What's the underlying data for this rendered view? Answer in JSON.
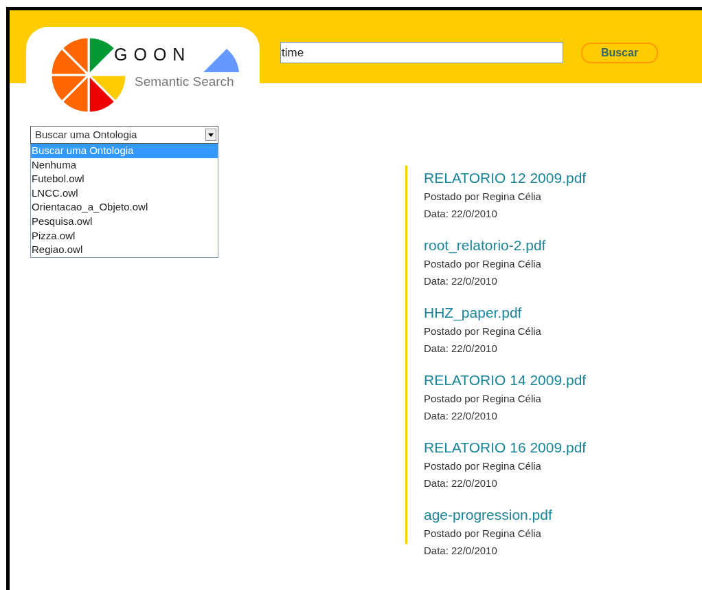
{
  "logo": {
    "name": "GOON",
    "subtitle": "Semantic Search"
  },
  "search": {
    "value": "time",
    "button": "Buscar"
  },
  "ontology_select": {
    "value": "Buscar uma Ontologia",
    "expanded": true,
    "options": [
      {
        "label": "Buscar uma Ontologia",
        "selected": true
      },
      {
        "label": "Nenhuma",
        "selected": false
      },
      {
        "label": "Futebol.owl",
        "selected": false
      },
      {
        "label": "LNCC.owl",
        "selected": false
      },
      {
        "label": "Orientacao_a_Objeto.owl",
        "selected": false
      },
      {
        "label": "Pesquisa.owl",
        "selected": false
      },
      {
        "label": "Pizza.owl",
        "selected": false
      },
      {
        "label": "Regiao.owl",
        "selected": false
      }
    ]
  },
  "results": [
    {
      "title": "RELATORIO 12 2009.pdf",
      "author": "Postado por Regina Célia",
      "date": "Data: 22/0/2010"
    },
    {
      "title": "root_relatorio-2.pdf",
      "author": "Postado por Regina Célia",
      "date": "Data: 22/0/2010"
    },
    {
      "title": "HHZ_paper.pdf",
      "author": "Postado por Regina Célia",
      "date": "Data: 22/0/2010"
    },
    {
      "title": "RELATORIO 14 2009.pdf",
      "author": "Postado por Regina Célia",
      "date": "Data: 22/0/2010"
    },
    {
      "title": "RELATORIO 16 2009.pdf",
      "author": "Postado por Regina Célia",
      "date": "Data: 22/0/2010"
    },
    {
      "title": "age-progression.pdf",
      "author": "Postado por Regina Célia",
      "date": "Data: 22/0/2010"
    }
  ]
}
